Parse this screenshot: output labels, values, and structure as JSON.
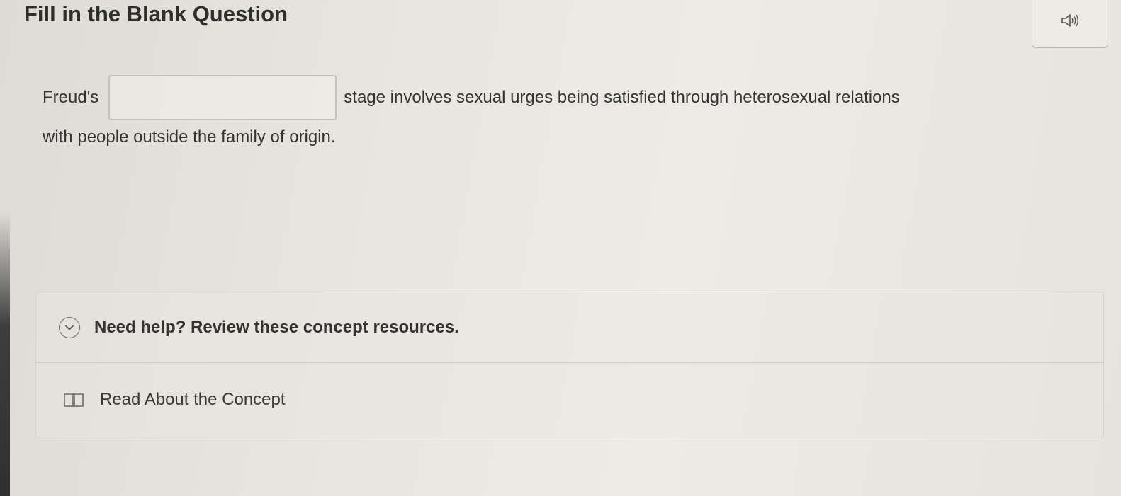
{
  "page": {
    "title": "Fill in the Blank Question"
  },
  "audio": {
    "icon": "speaker-icon"
  },
  "question": {
    "prefix": "Freud's",
    "blank_value": "",
    "suffix": "stage involves sexual urges being satisfied through heterosexual relations",
    "continuation": "with people outside the family of origin."
  },
  "help": {
    "label": "Need help? Review these concept resources.",
    "icon": "chevron-down-icon",
    "resources": [
      {
        "label": "Read About the Concept",
        "icon": "book-icon"
      }
    ]
  }
}
